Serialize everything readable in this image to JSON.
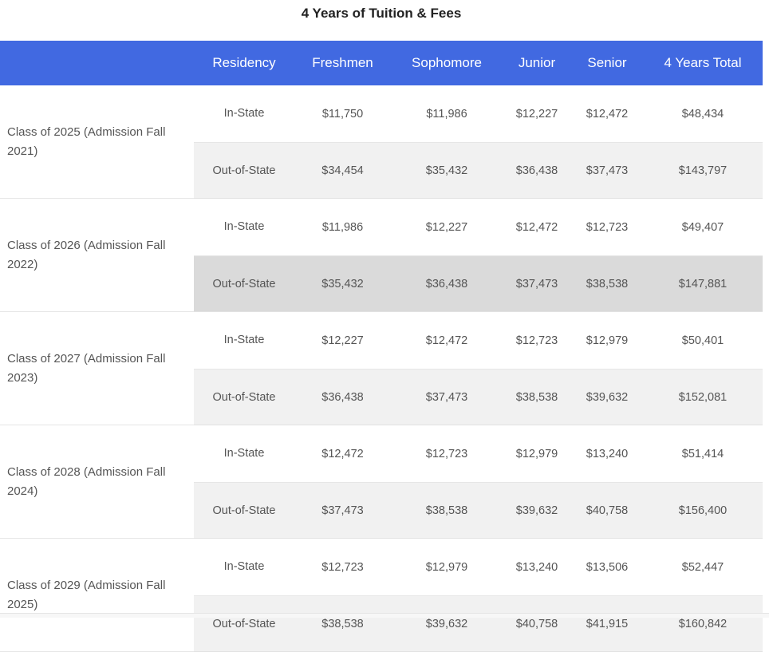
{
  "title": "4 Years of Tuition & Fees",
  "table": {
    "headers": [
      "",
      "Residency",
      "Freshmen",
      "Sophomore",
      "Junior",
      "Senior",
      "4 Years Total"
    ],
    "groups": [
      {
        "class_label": "Class of 2025 (Admission Fall 2021)",
        "rows": [
          {
            "residency": "In-State",
            "values": [
              "$11,750",
              "$11,986",
              "$12,227",
              "$12,472",
              "$48,434"
            ]
          },
          {
            "residency": "Out-of-State",
            "values": [
              "$34,454",
              "$35,432",
              "$36,438",
              "$37,473",
              "$143,797"
            ]
          }
        ]
      },
      {
        "class_label": "Class of 2026 (Admission Fall 2022)",
        "rows": [
          {
            "residency": "In-State",
            "values": [
              "$11,986",
              "$12,227",
              "$12,472",
              "$12,723",
              "$49,407"
            ]
          },
          {
            "residency": "Out-of-State",
            "values": [
              "$35,432",
              "$36,438",
              "$37,473",
              "$38,538",
              "$147,881"
            ]
          }
        ]
      },
      {
        "class_label": "Class of 2027 (Admission Fall 2023)",
        "rows": [
          {
            "residency": "In-State",
            "values": [
              "$12,227",
              "$12,472",
              "$12,723",
              "$12,979",
              "$50,401"
            ]
          },
          {
            "residency": "Out-of-State",
            "values": [
              "$36,438",
              "$37,473",
              "$38,538",
              "$39,632",
              "$152,081"
            ]
          }
        ]
      },
      {
        "class_label": "Class of 2028 (Admission Fall 2024)",
        "rows": [
          {
            "residency": "In-State",
            "values": [
              "$12,472",
              "$12,723",
              "$12,979",
              "$13,240",
              "$51,414"
            ]
          },
          {
            "residency": "Out-of-State",
            "values": [
              "$37,473",
              "$38,538",
              "$39,632",
              "$40,758",
              "$156,400"
            ]
          }
        ]
      },
      {
        "class_label": "Class of 2029 (Admission Fall 2025)",
        "rows": [
          {
            "residency": "In-State",
            "values": [
              "$12,723",
              "$12,979",
              "$13,240",
              "$13,506",
              "$52,447"
            ]
          },
          {
            "residency": "Out-of-State",
            "values": [
              "$38,538",
              "$39,632",
              "$40,758",
              "$41,915",
              "$160,842"
            ]
          }
        ]
      }
    ]
  },
  "colors": {
    "header_bg": "#4169e1",
    "header_text": "#ffffff",
    "alt_row_bg": "#f1f1f1",
    "hover_row_bg": "#dadada",
    "text": "#555555"
  }
}
